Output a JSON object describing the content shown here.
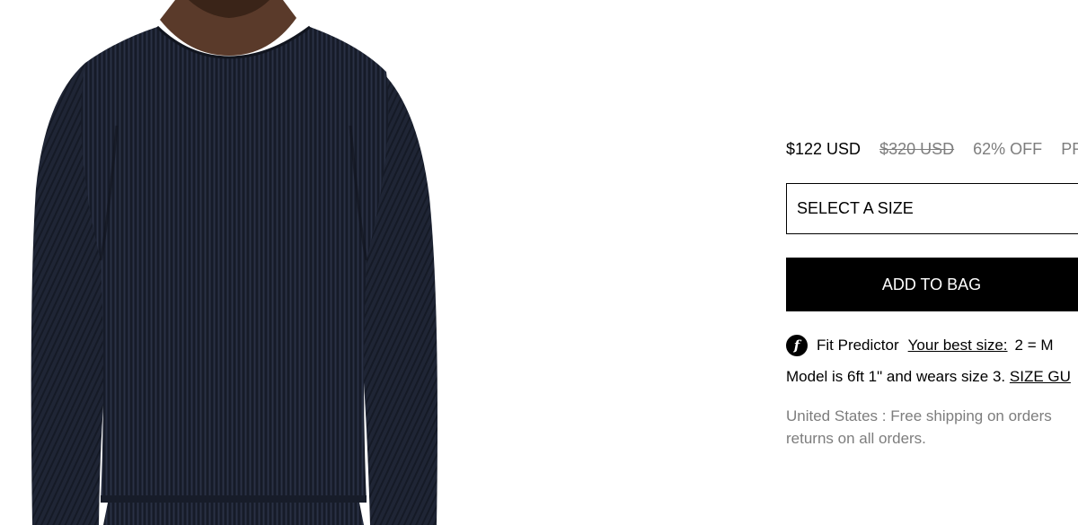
{
  "product": {
    "price_current": "$122 USD",
    "price_original": "$320 USD",
    "discount": "62% OFF",
    "price_extra": "PRIV"
  },
  "size_select": {
    "label": "SELECT A SIZE"
  },
  "add_to_bag": {
    "label": "ADD TO BAG"
  },
  "fit_predictor": {
    "icon": "fit-predictor-f-icon",
    "label": "Fit Predictor",
    "best_size_link": "Your best size:",
    "best_size_value": "2 = M"
  },
  "model_info": {
    "text": "Model is 6ft 1\" and wears size 3.",
    "size_guide_link": "SIZE GU"
  },
  "shipping": {
    "line1": "United States : Free shipping on orders",
    "line2": "returns on all orders."
  },
  "colors": {
    "garment": "#1d2333",
    "button_bg": "#000000",
    "muted_text": "#7d7d7d"
  }
}
